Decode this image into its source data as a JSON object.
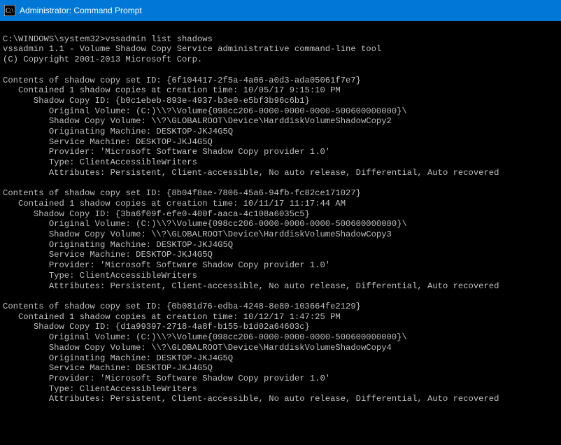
{
  "titlebar": {
    "title": "Administrator: Command Prompt"
  },
  "prompt": "C:\\WINDOWS\\system32>",
  "command": "vssadmin list shadows",
  "header1": "vssadmin 1.1 - Volume Shadow Copy Service administrative command-line tool",
  "header2": "(C) Copyright 2001-2013 Microsoft Corp.",
  "sets": [
    {
      "set_id": "{6f104417-2f5a-4a06-a0d3-ada05061f7e7}",
      "contained": "1",
      "creation_time": "10/05/17 9:15:10 PM",
      "shadow_id": "{b0c1ebeb-893e-4937-b3e0-e5bf3b96c6b1}",
      "original_volume": "(C:)\\\\?\\Volume{098cc206-0000-0000-0000-500600000000}\\",
      "shadow_volume": "\\\\?\\GLOBALROOT\\Device\\HarddiskVolumeShadowCopy2",
      "orig_machine": "DESKTOP-JKJ4G5Q",
      "service_machine": "DESKTOP-JKJ4G5Q",
      "provider": "'Microsoft Software Shadow Copy provider 1.0'",
      "type": "ClientAccessibleWriters",
      "attributes": "Persistent, Client-accessible, No auto release, Differential, Auto recovered"
    },
    {
      "set_id": "{8b04f8ae-7806-45a6-94fb-fc82ce171027}",
      "contained": "1",
      "creation_time": "10/11/17 11:17:44 AM",
      "shadow_id": "{3ba6f09f-efe0-400f-aaca-4c108a6035c5}",
      "original_volume": "(C:)\\\\?\\Volume{098cc206-0000-0000-0000-500600000000}\\",
      "shadow_volume": "\\\\?\\GLOBALROOT\\Device\\HarddiskVolumeShadowCopy3",
      "orig_machine": "DESKTOP-JKJ4G5Q",
      "service_machine": "DESKTOP-JKJ4G5Q",
      "provider": "'Microsoft Software Shadow Copy provider 1.0'",
      "type": "ClientAccessibleWriters",
      "attributes": "Persistent, Client-accessible, No auto release, Differential, Auto recovered"
    },
    {
      "set_id": "{0b081d76-edba-4248-8e80-103664fe2129}",
      "contained": "1",
      "creation_time": "10/12/17 1:47:25 PM",
      "shadow_id": "{d1a99397-2718-4a8f-b155-b1d02a64603c}",
      "original_volume": "(C:)\\\\?\\Volume{098cc206-0000-0000-0000-500600000000}\\",
      "shadow_volume": "\\\\?\\GLOBALROOT\\Device\\HarddiskVolumeShadowCopy4",
      "orig_machine": "DESKTOP-JKJ4G5Q",
      "service_machine": "DESKTOP-JKJ4G5Q",
      "provider": "'Microsoft Software Shadow Copy provider 1.0'",
      "type": "ClientAccessibleWriters",
      "attributes": "Persistent, Client-accessible, No auto release, Differential, Auto recovered"
    }
  ],
  "labels": {
    "contents": "Contents of shadow copy set ID: ",
    "contained_a": "   Contained ",
    "contained_b": " shadow copies at creation time: ",
    "shadow_id": "      Shadow Copy ID: ",
    "orig_vol": "         Original Volume: ",
    "shadow_vol": "         Shadow Copy Volume: ",
    "orig_mach": "         Originating Machine: ",
    "svc_mach": "         Service Machine: ",
    "provider": "         Provider: ",
    "type": "         Type: ",
    "attributes": "         Attributes: "
  }
}
